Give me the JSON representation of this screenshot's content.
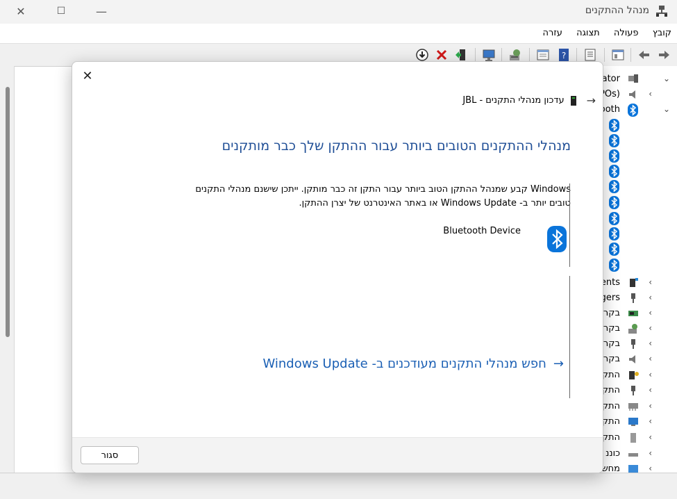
{
  "window": {
    "title": "מנהל ההתקנים",
    "controls": {
      "close": "✕",
      "maximize": "☐",
      "minimize": "—"
    }
  },
  "menu": [
    "קובץ",
    "פעולה",
    "תצוגה",
    "עזרה"
  ],
  "toolbar_icons": [
    "back-icon",
    "forward-icon",
    "properties-icon",
    "show-hide-icon",
    "help-icon",
    "view-icon",
    "scan-icon",
    "monitor-icon",
    "update-driver-icon",
    "uninstall-icon",
    "disable-icon"
  ],
  "tree": {
    "rows": [
      {
        "label": "istrator",
        "icon": "computer-icon",
        "chevron": "⌄"
      },
      {
        "label": "POs)",
        "icon": "speaker-icon",
        "chevron": "‹"
      },
      {
        "label": "ooth",
        "icon": "bluetooth-icon",
        "chevron": "⌄"
      },
      {
        "label": "ents",
        "icon": "component-icon",
        "chevron": "‹"
      },
      {
        "label": "gers",
        "icon": "usb-icon",
        "chevron": "‹"
      },
      {
        "label": "בקר",
        "icon": "controller-icon",
        "chevron": "‹"
      },
      {
        "label": "בקר",
        "icon": "storage-controller-icon",
        "chevron": "‹"
      },
      {
        "label": "בקר",
        "icon": "usb-controller-icon",
        "chevron": "‹"
      },
      {
        "label": "בקר",
        "icon": "audio-controller-icon",
        "chevron": "‹"
      },
      {
        "label": "התק",
        "icon": "security-device-icon",
        "chevron": "‹"
      },
      {
        "label": "התק",
        "icon": "usb-device-icon",
        "chevron": "‹"
      },
      {
        "label": "התק",
        "icon": "network-device-icon",
        "chevron": "‹"
      },
      {
        "label": "התק",
        "icon": "display-device-icon",
        "chevron": "‹"
      },
      {
        "label": "התק",
        "icon": "system-device-icon",
        "chevron": "‹"
      },
      {
        "label": "כוננ",
        "icon": "drive-icon",
        "chevron": "‹"
      },
      {
        "label": "מחש",
        "icon": "monitor-icon",
        "chevron": "‹"
      }
    ]
  },
  "dialog": {
    "close_icon": "✕",
    "breadcrumb": "עדכון מנהלי התקנים - JBL",
    "heading": "מנהלי ההתקנים הטובים ביותר עבור ההתקן שלך כבר מותקנים",
    "body_line1": "Windows קבע שמנהל ההתקן הטוב ביותר עבור התקן זה כבר מותקן. ייתכן שישנם מנהלי התקנים",
    "body_line2": "טובים יותר ב- Windows Update או באתר האינטרנט של יצרן ההתקן.",
    "device_name": "Bluetooth Device",
    "wu_link": "חפש מנהלי התקנים מעודכנים ב- Windows Update",
    "close_button": "סגור"
  },
  "colors": {
    "accent": "#0a74da",
    "heading": "#1f4e96",
    "link": "#1a5fb4"
  }
}
